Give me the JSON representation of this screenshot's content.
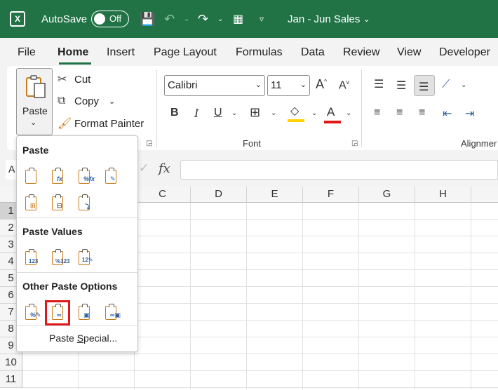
{
  "titlebar": {
    "autosave_label": "AutoSave",
    "autosave_state": "Off",
    "document_title": "Jan - Jun Sales",
    "brand_color": "#217346"
  },
  "tabs": [
    "File",
    "Home",
    "Insert",
    "Page Layout",
    "Formulas",
    "Data",
    "Review",
    "View",
    "Developer"
  ],
  "active_tab": "Home",
  "clipboard": {
    "paste_label": "Paste",
    "cut_label": "Cut",
    "copy_label": "Copy",
    "format_painter_label": "Format Painter"
  },
  "font": {
    "name": "Calibri",
    "size": "11",
    "group_label": "Font",
    "underline_color": "#ffd400",
    "font_color": "#e01818"
  },
  "alignment": {
    "group_label": "Alignmer"
  },
  "formula_bar": {
    "name_box": "A",
    "fx": "fx"
  },
  "grid": {
    "columns": [
      "C",
      "D",
      "E",
      "F",
      "G",
      "H"
    ],
    "rows": [
      "1",
      "2",
      "3",
      "4",
      "5",
      "6",
      "7",
      "8",
      "9",
      "10",
      "11"
    ]
  },
  "paste_menu": {
    "sections": [
      {
        "title": "Paste",
        "icons": [
          "paste-icon",
          "paste-formulas-icon",
          "paste-formulas-number-format-icon",
          "keep-source-formatting-icon",
          "no-borders-icon",
          "keep-column-widths-icon",
          "transpose-icon"
        ]
      },
      {
        "title": "Paste Values",
        "icons": [
          "values-icon",
          "values-number-format-icon",
          "values-source-formatting-icon"
        ]
      },
      {
        "title": "Other Paste Options",
        "icons": [
          "formatting-icon",
          "paste-link-icon",
          "picture-icon",
          "linked-picture-icon"
        ]
      }
    ],
    "highlighted": "paste-link-icon",
    "highlight_color": "#e01818",
    "paste_special_pre": "Paste ",
    "paste_special_u": "S",
    "paste_special_post": "pecial..."
  }
}
